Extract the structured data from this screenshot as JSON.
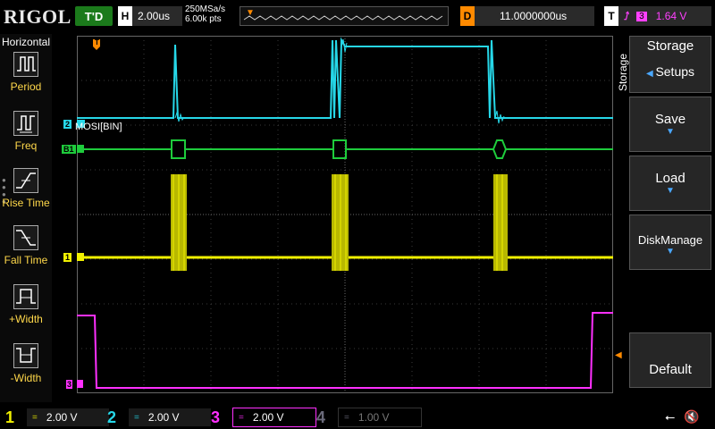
{
  "topbar": {
    "logo": "RIGOL",
    "trigger_status": "T'D",
    "timebase_label": "H",
    "timebase_value": "2.00us",
    "sample_rate": "250MSa/s",
    "memory_depth": "6.00k pts",
    "delay_label": "D",
    "delay_value": "11.0000000us",
    "trigger_label": "T",
    "trigger_source": "3",
    "trigger_level": "1.64 V"
  },
  "horizontal_menu": {
    "title": "Horizontal",
    "items": [
      {
        "label": "Period",
        "icon": "period-icon"
      },
      {
        "label": "Freq",
        "icon": "freq-icon"
      },
      {
        "label": "Rise Time",
        "icon": "rise-time-icon"
      },
      {
        "label": "Fall Time",
        "icon": "fall-time-icon"
      },
      {
        "label": "+Width",
        "icon": "pos-width-icon"
      },
      {
        "label": "-Width",
        "icon": "neg-width-icon"
      }
    ]
  },
  "storage_menu": {
    "vertical_label": "Storage",
    "title": "Storage",
    "setups": "Setups",
    "save": "Save",
    "load": "Load",
    "disk_manage": "DiskManage",
    "default": "Default"
  },
  "waveform_labels": {
    "ch2_marker": "2",
    "bus_marker": "B1",
    "ch1_marker": "1",
    "ch3_marker": "3",
    "decode_label": "MOSI[BIN]",
    "trigger_marker": "T"
  },
  "channels": [
    {
      "num": "1",
      "coupling": "=",
      "scale": "2.00 V",
      "color": "#f0f000"
    },
    {
      "num": "2",
      "coupling": "=",
      "scale": "2.00 V",
      "color": "#26d7e8"
    },
    {
      "num": "3",
      "coupling": "=",
      "scale": "2.00 V",
      "color": "#ff30ff"
    },
    {
      "num": "4",
      "coupling": "=",
      "scale": "1.00 V",
      "color": "#6a6a7a"
    }
  ],
  "colors": {
    "ch1": "#f0f000",
    "ch2": "#26d7e8",
    "ch3": "#ff30ff",
    "bus": "#1ecc3c",
    "trigger": "#ff8a00"
  }
}
